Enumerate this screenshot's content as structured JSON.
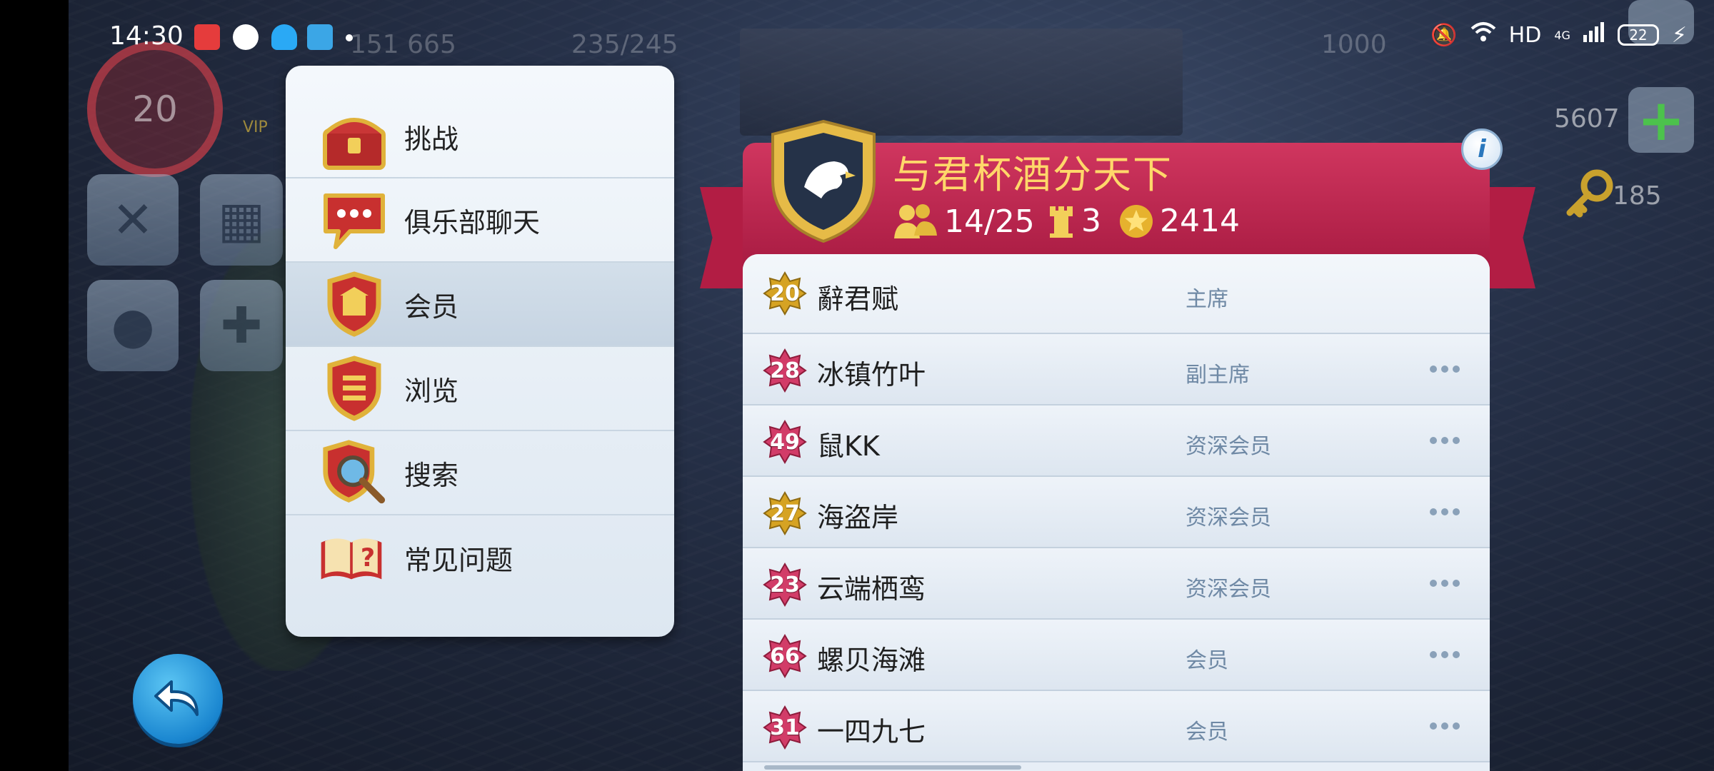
{
  "status_bar": {
    "time": "14:30",
    "network": "HD",
    "signal_type": "4G",
    "battery": "22",
    "notification_icons": [
      "toutiao-icon",
      "browser-icon",
      "qq-icon",
      "telegram-icon"
    ]
  },
  "hud": {
    "level": "20",
    "coins": "151 665",
    "population": "235/245",
    "value_1000": "1000",
    "cash": "5607",
    "keys": "185",
    "vip": "VIP"
  },
  "menu": {
    "items": [
      {
        "label": "挑战",
        "icon": "treasure-chest-icon"
      },
      {
        "label": "俱乐部聊天",
        "icon": "chat-bubble-icon"
      },
      {
        "label": "会员",
        "icon": "club-shield-icon"
      },
      {
        "label": "浏览",
        "icon": "list-shield-icon"
      },
      {
        "label": "搜索",
        "icon": "search-shield-icon"
      },
      {
        "label": "常见问题",
        "icon": "faq-book-icon"
      }
    ],
    "active_index": 2
  },
  "club": {
    "name": "与君杯酒分天下",
    "members": "14/25",
    "towers": "3",
    "points": "2414",
    "info": "i"
  },
  "members": [
    {
      "level": "20",
      "name": "辭君赋",
      "role": "主席",
      "badge": "gold"
    },
    {
      "level": "28",
      "name": "冰镇竹叶",
      "role": "副主席",
      "badge": "pink"
    },
    {
      "level": "49",
      "name": "鼠KK",
      "role": "资深会员",
      "badge": "pink"
    },
    {
      "level": "27",
      "name": "海盗岸",
      "role": "资深会员",
      "badge": "gold"
    },
    {
      "level": "23",
      "name": "云端栖鸾",
      "role": "资深会员",
      "badge": "pink"
    },
    {
      "level": "66",
      "name": "螺贝海滩",
      "role": "会员",
      "badge": "pink"
    },
    {
      "level": "31",
      "name": "一四九七",
      "role": "会员",
      "badge": "pink"
    }
  ],
  "colors": {
    "club_red": "#b21d44",
    "club_gold": "#ffd76a",
    "badge_pink": "#d23c68",
    "badge_gold": "#d6a323",
    "role_text": "#6f89a5"
  }
}
